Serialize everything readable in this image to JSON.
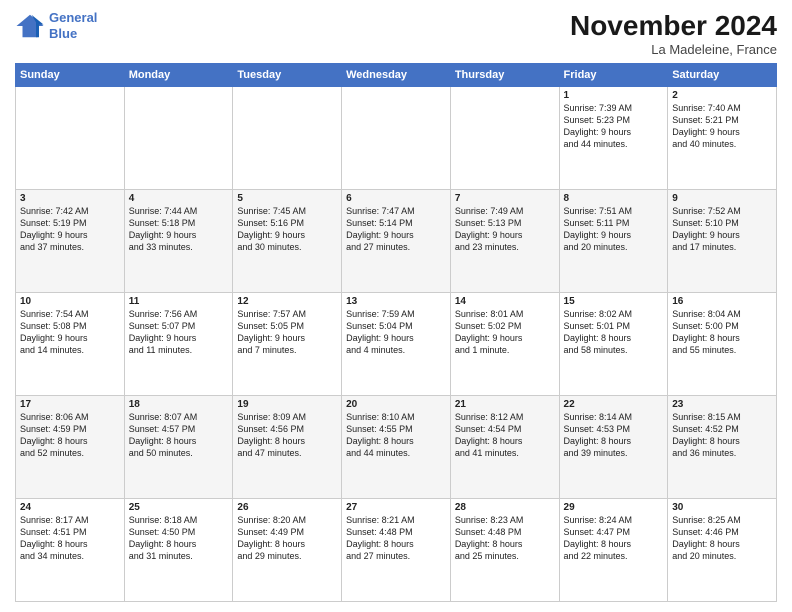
{
  "header": {
    "logo_line1": "General",
    "logo_line2": "Blue",
    "month": "November 2024",
    "location": "La Madeleine, France"
  },
  "columns": [
    "Sunday",
    "Monday",
    "Tuesday",
    "Wednesday",
    "Thursday",
    "Friday",
    "Saturday"
  ],
  "weeks": [
    [
      {
        "day": "",
        "info": ""
      },
      {
        "day": "",
        "info": ""
      },
      {
        "day": "",
        "info": ""
      },
      {
        "day": "",
        "info": ""
      },
      {
        "day": "",
        "info": ""
      },
      {
        "day": "1",
        "info": "Sunrise: 7:39 AM\nSunset: 5:23 PM\nDaylight: 9 hours\nand 44 minutes."
      },
      {
        "day": "2",
        "info": "Sunrise: 7:40 AM\nSunset: 5:21 PM\nDaylight: 9 hours\nand 40 minutes."
      }
    ],
    [
      {
        "day": "3",
        "info": "Sunrise: 7:42 AM\nSunset: 5:19 PM\nDaylight: 9 hours\nand 37 minutes."
      },
      {
        "day": "4",
        "info": "Sunrise: 7:44 AM\nSunset: 5:18 PM\nDaylight: 9 hours\nand 33 minutes."
      },
      {
        "day": "5",
        "info": "Sunrise: 7:45 AM\nSunset: 5:16 PM\nDaylight: 9 hours\nand 30 minutes."
      },
      {
        "day": "6",
        "info": "Sunrise: 7:47 AM\nSunset: 5:14 PM\nDaylight: 9 hours\nand 27 minutes."
      },
      {
        "day": "7",
        "info": "Sunrise: 7:49 AM\nSunset: 5:13 PM\nDaylight: 9 hours\nand 23 minutes."
      },
      {
        "day": "8",
        "info": "Sunrise: 7:51 AM\nSunset: 5:11 PM\nDaylight: 9 hours\nand 20 minutes."
      },
      {
        "day": "9",
        "info": "Sunrise: 7:52 AM\nSunset: 5:10 PM\nDaylight: 9 hours\nand 17 minutes."
      }
    ],
    [
      {
        "day": "10",
        "info": "Sunrise: 7:54 AM\nSunset: 5:08 PM\nDaylight: 9 hours\nand 14 minutes."
      },
      {
        "day": "11",
        "info": "Sunrise: 7:56 AM\nSunset: 5:07 PM\nDaylight: 9 hours\nand 11 minutes."
      },
      {
        "day": "12",
        "info": "Sunrise: 7:57 AM\nSunset: 5:05 PM\nDaylight: 9 hours\nand 7 minutes."
      },
      {
        "day": "13",
        "info": "Sunrise: 7:59 AM\nSunset: 5:04 PM\nDaylight: 9 hours\nand 4 minutes."
      },
      {
        "day": "14",
        "info": "Sunrise: 8:01 AM\nSunset: 5:02 PM\nDaylight: 9 hours\nand 1 minute."
      },
      {
        "day": "15",
        "info": "Sunrise: 8:02 AM\nSunset: 5:01 PM\nDaylight: 8 hours\nand 58 minutes."
      },
      {
        "day": "16",
        "info": "Sunrise: 8:04 AM\nSunset: 5:00 PM\nDaylight: 8 hours\nand 55 minutes."
      }
    ],
    [
      {
        "day": "17",
        "info": "Sunrise: 8:06 AM\nSunset: 4:59 PM\nDaylight: 8 hours\nand 52 minutes."
      },
      {
        "day": "18",
        "info": "Sunrise: 8:07 AM\nSunset: 4:57 PM\nDaylight: 8 hours\nand 50 minutes."
      },
      {
        "day": "19",
        "info": "Sunrise: 8:09 AM\nSunset: 4:56 PM\nDaylight: 8 hours\nand 47 minutes."
      },
      {
        "day": "20",
        "info": "Sunrise: 8:10 AM\nSunset: 4:55 PM\nDaylight: 8 hours\nand 44 minutes."
      },
      {
        "day": "21",
        "info": "Sunrise: 8:12 AM\nSunset: 4:54 PM\nDaylight: 8 hours\nand 41 minutes."
      },
      {
        "day": "22",
        "info": "Sunrise: 8:14 AM\nSunset: 4:53 PM\nDaylight: 8 hours\nand 39 minutes."
      },
      {
        "day": "23",
        "info": "Sunrise: 8:15 AM\nSunset: 4:52 PM\nDaylight: 8 hours\nand 36 minutes."
      }
    ],
    [
      {
        "day": "24",
        "info": "Sunrise: 8:17 AM\nSunset: 4:51 PM\nDaylight: 8 hours\nand 34 minutes."
      },
      {
        "day": "25",
        "info": "Sunrise: 8:18 AM\nSunset: 4:50 PM\nDaylight: 8 hours\nand 31 minutes."
      },
      {
        "day": "26",
        "info": "Sunrise: 8:20 AM\nSunset: 4:49 PM\nDaylight: 8 hours\nand 29 minutes."
      },
      {
        "day": "27",
        "info": "Sunrise: 8:21 AM\nSunset: 4:48 PM\nDaylight: 8 hours\nand 27 minutes."
      },
      {
        "day": "28",
        "info": "Sunrise: 8:23 AM\nSunset: 4:48 PM\nDaylight: 8 hours\nand 25 minutes."
      },
      {
        "day": "29",
        "info": "Sunrise: 8:24 AM\nSunset: 4:47 PM\nDaylight: 8 hours\nand 22 minutes."
      },
      {
        "day": "30",
        "info": "Sunrise: 8:25 AM\nSunset: 4:46 PM\nDaylight: 8 hours\nand 20 minutes."
      }
    ]
  ]
}
